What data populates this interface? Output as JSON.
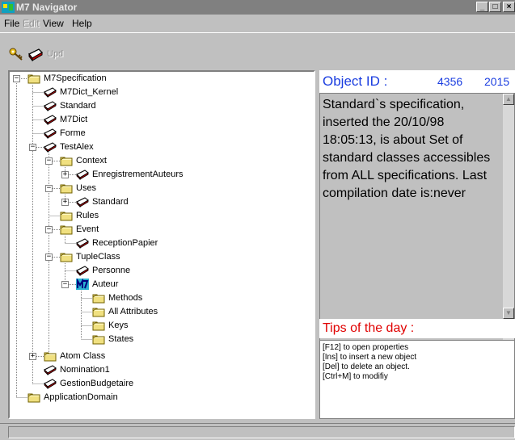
{
  "window": {
    "title": "M7 Navigator",
    "controls": [
      "_",
      "□",
      "×"
    ]
  },
  "menu": [
    {
      "label": "File",
      "enabled": true
    },
    {
      "label": "Edit",
      "enabled": false
    },
    {
      "label": "View",
      "enabled": true
    },
    {
      "label": "Help",
      "enabled": true
    }
  ],
  "toolbar": {
    "key_icon": "key-icon",
    "print_icon": "class-icon",
    "upd_label": "Upd"
  },
  "tree": [
    {
      "label": "M7Specification",
      "icon": "folder-icon",
      "expander": "−"
    },
    {
      "label": "M7Dict_Kernel",
      "icon": "class-icon"
    },
    {
      "label": "Standard",
      "icon": "class-icon"
    },
    {
      "label": "M7Dict",
      "icon": "class-icon"
    },
    {
      "label": "Forme",
      "icon": "class-icon"
    },
    {
      "label": "TestAlex",
      "icon": "class-icon",
      "expander": "−"
    },
    {
      "label": "Context",
      "icon": "folder-icon",
      "expander": "−"
    },
    {
      "label": "EnregistrementAuteurs",
      "icon": "class-icon",
      "expander": "+"
    },
    {
      "label": "Uses",
      "icon": "folder-icon",
      "expander": "−"
    },
    {
      "label": "Standard",
      "icon": "class-icon",
      "expander": "+"
    },
    {
      "label": "Rules",
      "icon": "folder-icon"
    },
    {
      "label": "Event",
      "icon": "folder-icon",
      "expander": "−"
    },
    {
      "label": "ReceptionPapier",
      "icon": "class-icon"
    },
    {
      "label": "TupleClass",
      "icon": "folder-icon",
      "expander": "−"
    },
    {
      "label": "Personne",
      "icon": "class-icon"
    },
    {
      "label": "Auteur",
      "icon": "m7-icon",
      "expander": "−"
    },
    {
      "label": "Methods",
      "icon": "folder-icon"
    },
    {
      "label": "All Attributes",
      "icon": "folder-icon"
    },
    {
      "label": "Keys",
      "icon": "folder-icon"
    },
    {
      "label": "States",
      "icon": "folder-icon"
    },
    {
      "label": "Atom Class",
      "icon": "folder-icon",
      "expander": "+"
    },
    {
      "label": "Nomination1",
      "icon": "class-icon"
    },
    {
      "label": "GestionBudgetaire",
      "icon": "class-icon"
    },
    {
      "label": "ApplicationDomain",
      "icon": "folder-icon"
    }
  ],
  "object": {
    "id_label": "Object ID :",
    "id_value_1": "4356",
    "id_value_2": "2015",
    "description": "Standard`s specification, inserted the 20/10/98 18:05:13, is about Set of standard classes accessibles from ALL specifications. Last compilation date is:never"
  },
  "tips": {
    "title": "Tips of the day :",
    "lines": [
      "[F12] to open properties",
      "[Ins]  to insert a new object",
      "[Del] to delete an object.",
      "[Ctrl+M] to modifiy"
    ]
  },
  "colors": {
    "accent_blue": "#1a3de0",
    "tips_red": "#e00000",
    "titlebar_inactive": "#808080"
  }
}
